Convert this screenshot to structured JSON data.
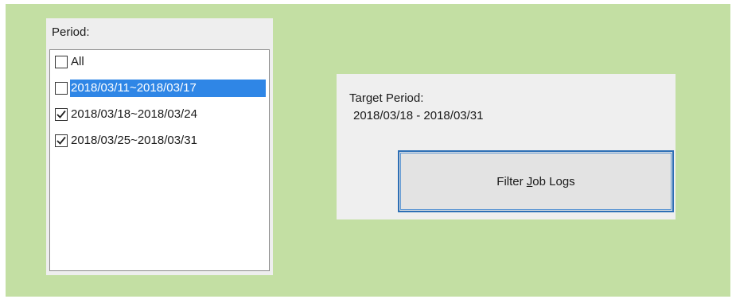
{
  "colors": {
    "background": "#c3dfa3",
    "selection": "#2f86e6",
    "button_border": "#2d6fb5"
  },
  "period": {
    "label": "Period:",
    "items": [
      {
        "label": "All",
        "checked": false,
        "selected": false
      },
      {
        "label": "2018/03/11~2018/03/17",
        "checked": false,
        "selected": true
      },
      {
        "label": "2018/03/18~2018/03/24",
        "checked": true,
        "selected": false
      },
      {
        "label": "2018/03/25~2018/03/31",
        "checked": true,
        "selected": false
      }
    ]
  },
  "target": {
    "label": "Target Period:",
    "value": "2018/03/18 - 2018/03/31"
  },
  "filter_button": {
    "before_mnemonic": "Filter ",
    "mnemonic": "J",
    "after_mnemonic": "ob Logs"
  }
}
